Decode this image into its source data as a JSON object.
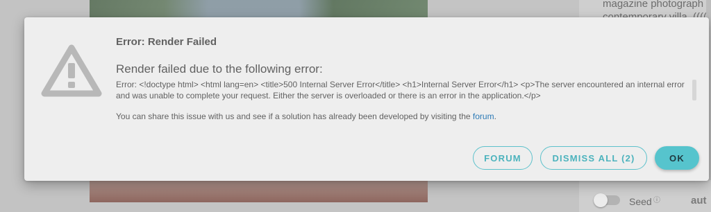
{
  "background": {
    "prompt_text": [
      "magazine photograph of a",
      "contemporary villa, ((((ind"
    ],
    "seed_label": "Seed",
    "seed_info": "ⓘ",
    "seed_value": "aut"
  },
  "dialog": {
    "title": "Error: Render Failed",
    "subtitle": "Render failed due to the following error:",
    "error_message": "Error: <!doctype html> <html lang=en> <title>500 Internal Server Error</title> <h1>Internal Server Error</h1> <p>The server encountered an internal error and was unable to complete your request. Either the server is overloaded or there is an error in the application.</p>",
    "share_text": "You can share this issue with us and see if a solution has already been developed by visiting the ",
    "share_link": "forum",
    "share_end": ".",
    "buttons": {
      "forum": "FORUM",
      "dismiss_all": "DISMISS ALL (2)",
      "ok": "OK"
    },
    "accent_color": "#56c4cd",
    "icon": "warning-icon"
  }
}
